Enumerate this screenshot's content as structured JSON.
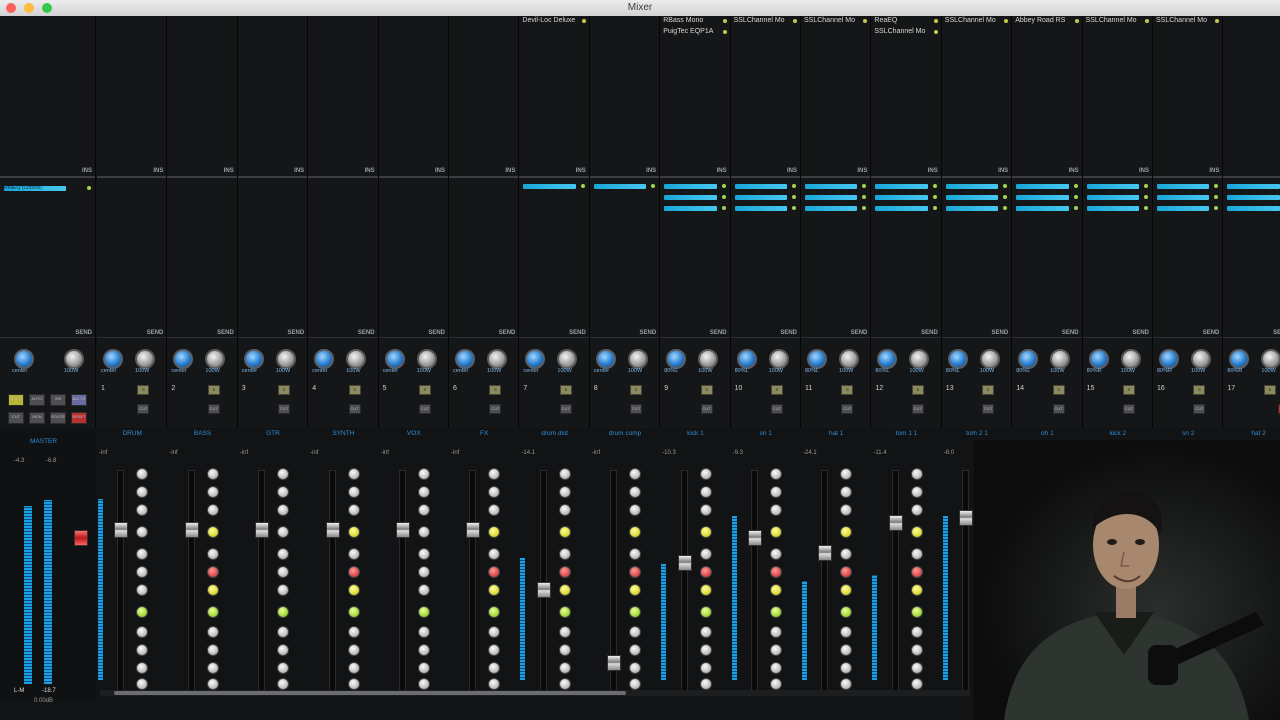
{
  "window": {
    "title": "Mixer"
  },
  "master": {
    "label": "MASTER",
    "pan_label": "center",
    "vol_label": "100W",
    "readout_left": "-4.3",
    "readout_right": "-6.8",
    "mode_label": "L-M",
    "level_value": "-18.7",
    "gain_value": "0.00dB",
    "master_fx": "ReaEQ (Cockos)",
    "buttons": [
      "SOLO",
      "AUTO",
      "INS",
      "ALL FX",
      "CUT",
      "MON",
      "ROUTE",
      "RESET"
    ]
  },
  "channels": [
    {
      "num": "1",
      "name": "DRUM",
      "pan": "center",
      "vol": "100W",
      "peak": "-inf",
      "gain": "0.00dB",
      "fx": []
    },
    {
      "num": "2",
      "name": "BASS",
      "pan": "center",
      "vol": "100W",
      "peak": "-inf",
      "gain": "0.00dB",
      "fx": []
    },
    {
      "num": "3",
      "name": "GTR",
      "pan": "center",
      "vol": "100W",
      "peak": "-inf",
      "gain": "0.00dB",
      "fx": []
    },
    {
      "num": "4",
      "name": "SYNTH",
      "pan": "center",
      "vol": "100W",
      "peak": "-inf",
      "gain": "0.00dB",
      "fx": []
    },
    {
      "num": "5",
      "name": "VOX",
      "pan": "center",
      "vol": "100W",
      "peak": "-inf",
      "gain": "0.00dB",
      "fx": []
    },
    {
      "num": "6",
      "name": "FX",
      "pan": "center",
      "vol": "100W",
      "peak": "-inf",
      "gain": "0.00dB",
      "fx": []
    },
    {
      "num": "7",
      "name": "drum dist",
      "pan": "center",
      "vol": "100W",
      "peak": "-14.1",
      "gain": "-16.0dB",
      "fx": [
        "Devil-Loc Deluxe"
      ]
    },
    {
      "num": "8",
      "name": "drum comp",
      "pan": "center",
      "vol": "100W",
      "peak": "-inf",
      "gain": "-inf dB",
      "fx": []
    },
    {
      "num": "9",
      "name": "kick 1",
      "pan": "80%L",
      "vol": "100W",
      "peak": "-10.3",
      "gain": "-7.40dB",
      "fx": [
        "RBass Mono",
        "PuigTec EQP1A"
      ]
    },
    {
      "num": "10",
      "name": "sn 1",
      "pan": "80%L",
      "vol": "100W",
      "peak": "-9.3",
      "gain": "-1.36dB",
      "fx": [
        "SSLChannel Mo"
      ]
    },
    {
      "num": "11",
      "name": "hat 1",
      "pan": "80%L",
      "vol": "100W",
      "peak": "-24.1",
      "gain": "-6.13dB",
      "fx": [
        "SSLChannel Mo"
      ]
    },
    {
      "num": "12",
      "name": "tom 1 1",
      "pan": "80%L",
      "vol": "100W",
      "peak": "-11.4",
      "gain": "+1.82dB",
      "fx": [
        "ReaEQ",
        "SSLChannel Mo"
      ]
    },
    {
      "num": "13",
      "name": "tom 2 1",
      "pan": "80%L",
      "vol": "100W",
      "peak": "-8.0",
      "gain": "+5.02dB",
      "fx": [
        "SSLChannel Mo"
      ]
    },
    {
      "num": "14",
      "name": "oh 1",
      "pan": "80%L",
      "vol": "100W",
      "peak": "",
      "gain": "",
      "fx": [
        "Abbey Road RS"
      ]
    },
    {
      "num": "15",
      "name": "kick 2",
      "pan": "80%R",
      "vol": "100W",
      "peak": "",
      "gain": "",
      "fx": [
        "SSLChannel Mo"
      ]
    },
    {
      "num": "16",
      "name": "sn 2",
      "pan": "80%R",
      "vol": "100W",
      "peak": "",
      "gain": "",
      "fx": [
        "SSLChannel Mo"
      ]
    },
    {
      "num": "17",
      "name": "hat 2",
      "pan": "80%R",
      "vol": "100W",
      "peak": "",
      "gain": "",
      "fx": []
    }
  ],
  "labels": {
    "ins": "INS",
    "send": "SEND",
    "solo": "S",
    "cut": "CUT",
    "cut_active": "CUT"
  },
  "colors": {
    "meter": "#1aa0e6",
    "accent_blue": "#2f8fd8",
    "record_red": "#c81c1c",
    "solo_yellow": "#c9c200",
    "fx_cyan": "#46c8ef"
  }
}
